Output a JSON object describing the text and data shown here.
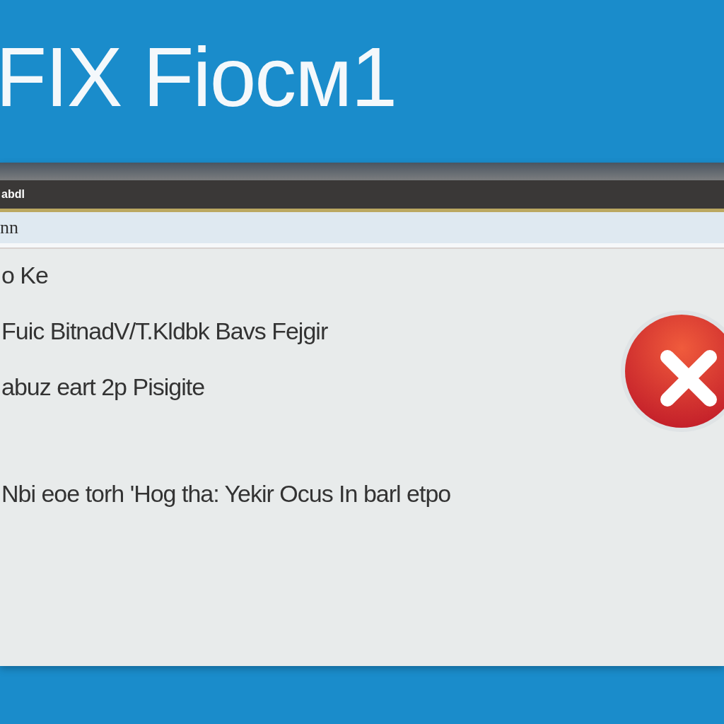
{
  "headline": "FIX Fiocм1",
  "window": {
    "title": "abdl",
    "address": "nn"
  },
  "message": {
    "lines": [
      "o  Ke",
      "Fuic BitnadV/T.Kldbk  Bavs Fejgir",
      "abuz  eart 2p  Pisigite"
    ],
    "footer": "Nbi eoe torh 'Hog tha:   Yekir  Ocus In barl etpo"
  },
  "icon": {
    "kind": "error"
  }
}
